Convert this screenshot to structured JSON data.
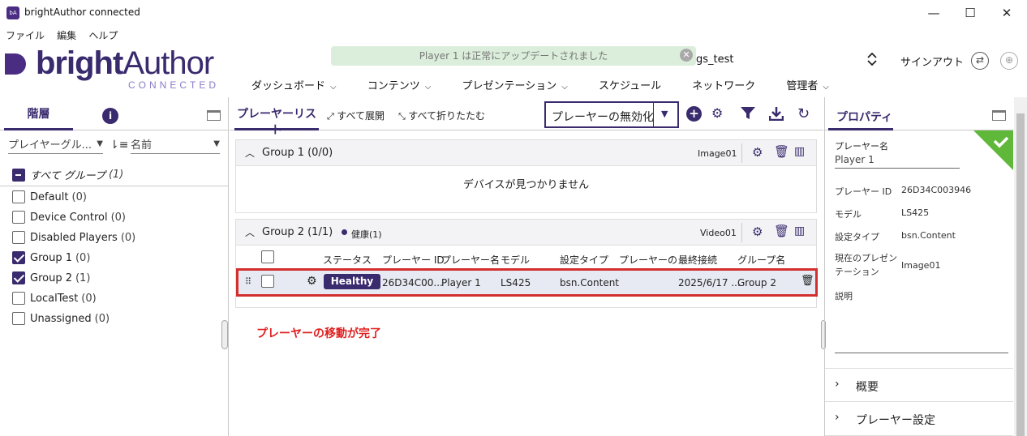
{
  "window": {
    "title": "brightAuthor connected",
    "icon_label": "bA",
    "controls": [
      "—",
      "☐",
      "✕"
    ]
  },
  "menu": [
    "ファイル",
    "編集",
    "ヘルプ"
  ],
  "logo": {
    "bright": "bright",
    "author": "Author",
    "connected": "CONNECTED"
  },
  "toast": {
    "message": "Player 1 は正常にアップデートされました"
  },
  "header": {
    "account": "gs_test",
    "signout": "サインアウト"
  },
  "nav": [
    {
      "label": "ダッシュボード",
      "has_dropdown": true
    },
    {
      "label": "コンテンツ",
      "has_dropdown": true
    },
    {
      "label": "プレゼンテーション",
      "has_dropdown": true
    },
    {
      "label": "スケジュール",
      "has_dropdown": false
    },
    {
      "label": "ネットワーク",
      "has_dropdown": false
    },
    {
      "label": "管理者",
      "has_dropdown": true
    }
  ],
  "left": {
    "tab": "階層",
    "filter_select": "プレイヤーグル...",
    "sort_select": "名前",
    "all_groups": {
      "label": "すべて グループ",
      "count": "(1)"
    },
    "groups": [
      {
        "label": "Default",
        "count": "(0)",
        "checked": false
      },
      {
        "label": "Device Control",
        "count": "(0)",
        "checked": false
      },
      {
        "label": "Disabled Players",
        "count": "(0)",
        "checked": false
      },
      {
        "label": "Group 1",
        "count": "(0)",
        "checked": true
      },
      {
        "label": "Group 2",
        "count": "(1)",
        "checked": true
      },
      {
        "label": "LocalTest",
        "count": "(0)",
        "checked": false
      },
      {
        "label": "Unassigned",
        "count": "(0)",
        "checked": false
      }
    ]
  },
  "middle": {
    "tab": "プレーヤーリスト",
    "expand_all": "すべて展開",
    "collapse_all": "すべて折りたたむ",
    "action_select": "プレーヤーの無効化",
    "group1": {
      "title": "Group 1 (0/0)",
      "presentation": "Image01",
      "empty_message": "デバイスが見つかりません"
    },
    "group2": {
      "title": "Group 2 (1/1)",
      "health": "健康(1)",
      "presentation": "Video01",
      "columns": [
        "ステータス",
        "プレーヤー ID",
        "プレーヤー名",
        "モデル",
        "設定タイプ",
        "プレーヤーの説明",
        "最終接続",
        "グループ名"
      ],
      "row": {
        "status": "Healthy",
        "player_id": "26D34C00...",
        "player_name": "Player 1",
        "model": "LS425",
        "setup_type": "bsn.Content",
        "description": "",
        "last_connected": "2025/6/17 ...",
        "group": "Group 2"
      }
    },
    "annotation": "プレーヤーの移動が完了"
  },
  "right": {
    "tab": "プロパティ",
    "player_name_label": "プレーヤー名",
    "player_name_value": "Player 1",
    "props": [
      {
        "label": "プレーヤー ID",
        "value": "26D34C003946"
      },
      {
        "label": "モデル",
        "value": "LS425"
      },
      {
        "label": "設定タイプ",
        "value": "bsn.Content"
      },
      {
        "label": "現在のプレゼンテーション",
        "value": "Image01"
      }
    ],
    "description_label": "説明",
    "sections": [
      "概要",
      "プレーヤー設定"
    ]
  },
  "colors": {
    "brand": "#3a2a6e",
    "highlight_red": "#d32f2f",
    "healthy_bg": "#3a2a6e",
    "toast_bg": "#dbeedb",
    "check_green": "#5fb83a"
  }
}
